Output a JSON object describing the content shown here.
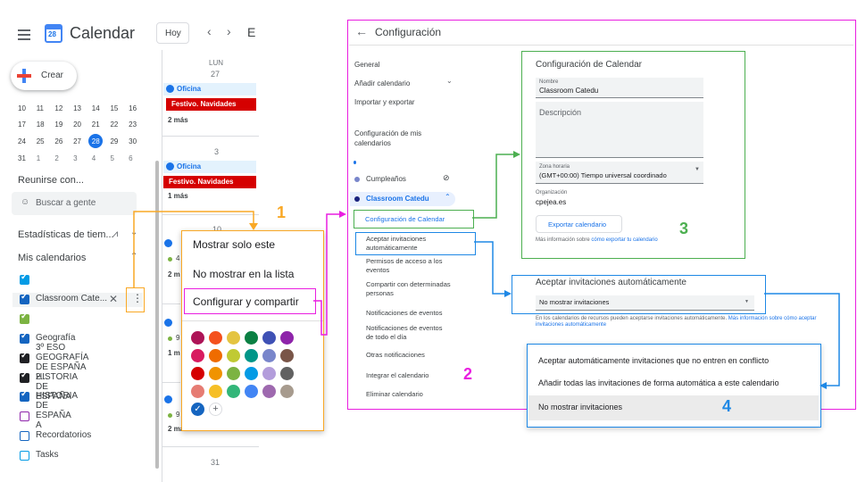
{
  "app": {
    "title": "Calendar",
    "logo_number": "28",
    "today_button": "Hoy",
    "header_letter": "E"
  },
  "sidebar": {
    "create_label": "Crear",
    "mini_calendar_rows": [
      [
        "10",
        "11",
        "12",
        "13",
        "14",
        "15",
        "16"
      ],
      [
        "17",
        "18",
        "19",
        "20",
        "21",
        "22",
        "23"
      ],
      [
        "24",
        "25",
        "26",
        "27",
        "28",
        "29",
        "30"
      ],
      [
        "31",
        "1",
        "2",
        "3",
        "4",
        "5",
        "6"
      ]
    ],
    "selected_day": "28",
    "meet_heading": "Reunirse con...",
    "search_people": "Buscar a gente",
    "stats_heading": "Estadísticas de tiem...",
    "my_calendars_heading": "Mis calendarios",
    "calendars": [
      {
        "label": "",
        "color": "#039be5"
      },
      {
        "label": "Classroom Cate...",
        "color": "#1565c0"
      },
      {
        "label": "",
        "color": "#7cb342"
      },
      {
        "label": "Geografía 3º ESO",
        "color": "#1565c0"
      },
      {
        "label": "GEOGRAFÍA DE ESPAÑA 2...",
        "color": "#202124"
      },
      {
        "label": "HISTORIA DE ESPAÑA",
        "color": "#202124"
      },
      {
        "label": "HISTORIA DE ESPAÑA A",
        "color": "#1565c0"
      },
      {
        "label": "",
        "color": "#8e24aa"
      },
      {
        "label": "Recordatorios",
        "color": "#1565c0"
      },
      {
        "label": "Tasks",
        "color": "#039be5"
      }
    ]
  },
  "grid": {
    "day_name": "LUN",
    "day_numbers": [
      "27",
      "3",
      "10",
      "31"
    ],
    "oficina": "Oficina",
    "festivo": "Festivo. Navidades",
    "more_2": "2 más",
    "more_1": "1 más",
    "partial_rows": [
      "4",
      "2 m",
      "9",
      "1 m",
      "9",
      "2 más"
    ]
  },
  "popup": {
    "show_only": "Mostrar solo este",
    "hide": "No mostrar en la lista",
    "configure": "Configurar y compartir",
    "colors": [
      [
        "#ad1457",
        "#f4511e",
        "#e4c441",
        "#0b8043",
        "#3f51b5",
        "#8e24aa"
      ],
      [
        "#d81b60",
        "#ef6c00",
        "#c0ca33",
        "#009688",
        "#7986cb",
        "#795548"
      ],
      [
        "#d50000",
        "#f09300",
        "#7cb342",
        "#039be5",
        "#b39ddb",
        "#616161"
      ],
      [
        "#e67c73",
        "#f6bf26",
        "#33b679",
        "#4285f4",
        "#9e69af",
        "#a79b8e"
      ]
    ]
  },
  "settings": {
    "title": "Configuración",
    "nav": {
      "general": "General",
      "add_calendar": "Añadir calendario",
      "import_export": "Importar y exportar",
      "my_calendars_config": "Configuración de mis calendarios",
      "birthdays": "Cumpleaños",
      "classroom": "Classroom Catedu",
      "calendar_settings": "Configuración de Calendar",
      "auto_accept": "Aceptar invitaciones automáticamente",
      "access": "Permisos de acceso a los eventos",
      "share": "Compartir con determinadas personas",
      "event_notifications": "Notificaciones de eventos",
      "allday_notifications": "Notificaciones de eventos de todo el día",
      "other_notifications": "Otras notificaciones",
      "integrate": "Integrar el calendario",
      "delete": "Eliminar calendario"
    },
    "calendar_settings": {
      "heading": "Configuración de Calendar",
      "name_label": "Nombre",
      "name_value": "Classroom Catedu",
      "description_placeholder": "Descripción",
      "timezone_label": "Zona horaria",
      "timezone_value": "(GMT+00:00) Tiempo universal coordinado",
      "org_label": "Organización",
      "org_value": "cpejea.es",
      "export_button": "Exportar calendario",
      "more_info_prefix": "Más información sobre ",
      "more_info_link": "cómo exportar tu calendario"
    },
    "auto_accept": {
      "heading": "Aceptar invitaciones automáticamente",
      "selected": "No mostrar invitaciones",
      "note_prefix": "En los calendarios de recursos pueden aceptarse invitaciones automáticamente.",
      "note_link": "Más información sobre cómo aceptar invitaciones automáticamente",
      "options": [
        "Aceptar automáticamente invitaciones que no entren en conflicto",
        "Añadir todas las invitaciones de forma automática a este calendario",
        "No mostrar invitaciones"
      ]
    }
  },
  "annotations": {
    "n1": "1",
    "n2": "2",
    "n3": "3",
    "n4": "4",
    "orange": "#f9a825",
    "magenta": "#e91ee0",
    "green": "#4caf50",
    "blue": "#1e88e5"
  }
}
